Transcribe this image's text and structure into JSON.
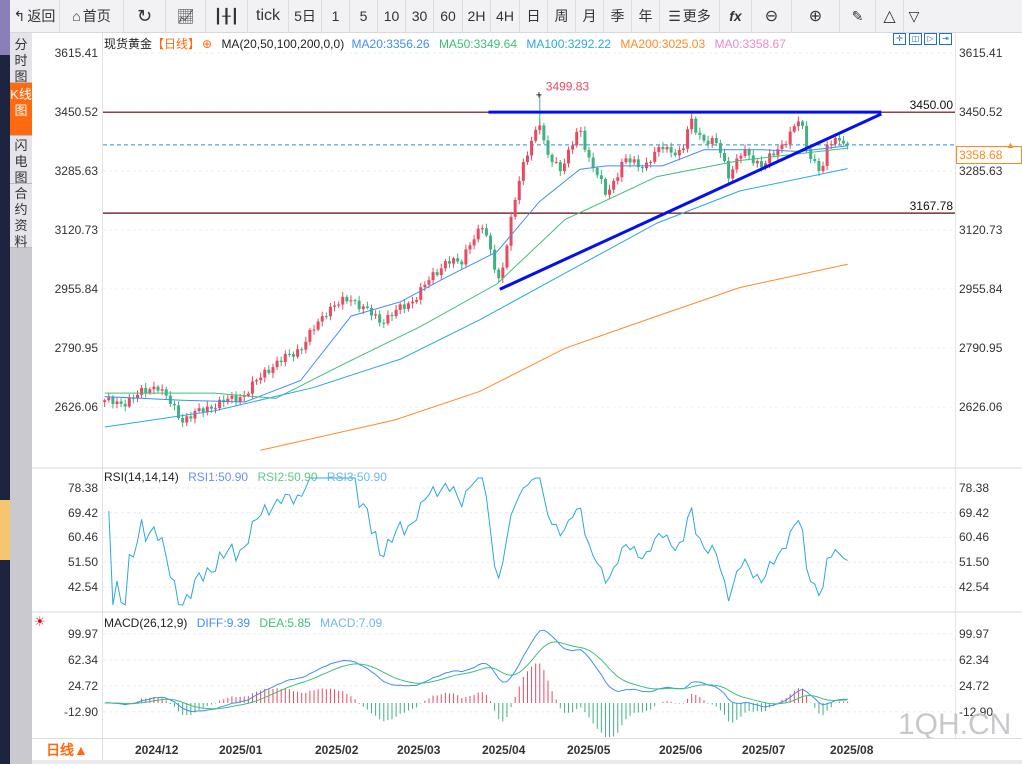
{
  "toolbar": {
    "back": "返回",
    "home": "首页",
    "tick": "tick",
    "p5d": "5日",
    "m1": "1",
    "m5": "5",
    "m10": "10",
    "m30": "30",
    "m60": "60",
    "h2": "2H",
    "h4": "4H",
    "day": "日",
    "week": "周",
    "month": "月",
    "quarter": "季",
    "year": "年",
    "more": "更多",
    "fx": "fx"
  },
  "sidebar": {
    "items": [
      {
        "label": "分时图"
      },
      {
        "label": "K线图",
        "active": true
      },
      {
        "label": "闪电图"
      },
      {
        "label": "合约资料"
      }
    ]
  },
  "main": {
    "symbol": "现货黄金",
    "period": "【日线】",
    "ma_label": "MA(20,50,100,200,0,0)",
    "ma20": "MA20:3356.26",
    "ma50": "MA50:3349.64",
    "ma100": "MA100:3292.22",
    "ma200": "MA200:3025.03",
    "ma0": "MA0:3358.67",
    "axis_ticks": [
      "3615.41",
      "3450.52",
      "3285.63",
      "3120.73",
      "2955.84",
      "2790.95",
      "2626.06"
    ],
    "resistance_label": "3450.00",
    "support_label": "3167.78",
    "high_label": "3499.83",
    "last_price": "3358.68"
  },
  "rsi": {
    "label": "RSI(14,14,14)",
    "rsi1": "RSI1:50.90",
    "rsi2": "RSI2:50.90",
    "rsi3": "RSI3:50.90",
    "axis_ticks": [
      "78.38",
      "69.42",
      "60.46",
      "51.50",
      "42.54"
    ]
  },
  "macd": {
    "label": "MACD(26,12,9)",
    "diff": "DIFF:9.39",
    "dea": "DEA:5.85",
    "macd": "MACD:7.09",
    "axis_ticks": [
      "99.97",
      "62.34",
      "24.72",
      "-12.90"
    ]
  },
  "bottom": {
    "period_button": "日线▲",
    "months": [
      "2024/12",
      "2025/01",
      "2025/02",
      "2025/03",
      "2025/04",
      "2025/05",
      "2025/06",
      "2025/07",
      "2025/08"
    ]
  },
  "watermark": "1QH.CN",
  "colors": {
    "up": "#e84a5f",
    "down": "#3fb27f",
    "ma20": "#3e8ef7",
    "ma50": "#3cc07a",
    "ma100": "#2aa8e0",
    "ma200": "#ff8a2a",
    "trendline": "#0010ee",
    "level": "#5a0a0a",
    "last": "#1f8ff0"
  },
  "chart_data": {
    "type": "candlestick",
    "y_range": [
      2626.06,
      3615.41
    ],
    "closes": [
      [
        "2024-11-21",
        2645
      ],
      [
        "2024-11-26",
        2632
      ],
      [
        "2024-12-10",
        2688
      ],
      [
        "2024-12-19",
        2590
      ],
      [
        "2024-12-31",
        2632
      ],
      [
        "2025-01-10",
        2660
      ],
      [
        "2025-01-17",
        2730
      ],
      [
        "2025-01-28",
        2790
      ],
      [
        "2025-02-06",
        2900
      ],
      [
        "2025-02-14",
        2930
      ],
      [
        "2025-02-24",
        2865
      ],
      [
        "2025-03-07",
        2920
      ],
      [
        "2025-03-14",
        2985
      ],
      [
        "2025-03-20",
        3037
      ],
      [
        "2025-03-25",
        3023
      ],
      [
        "2025-03-28",
        3085
      ],
      [
        "2025-04-02",
        3130
      ],
      [
        "2025-04-08",
        2975
      ],
      [
        "2025-04-14",
        3230
      ],
      [
        "2025-04-17",
        3330
      ],
      [
        "2025-04-22",
        3420
      ],
      [
        "2025-04-24",
        3340
      ],
      [
        "2025-04-30",
        3290
      ],
      [
        "2025-05-06",
        3410
      ],
      [
        "2025-05-09",
        3320
      ],
      [
        "2025-05-15",
        3220
      ],
      [
        "2025-05-21",
        3316
      ],
      [
        "2025-05-28",
        3300
      ],
      [
        "2025-06-03",
        3355
      ],
      [
        "2025-06-10",
        3330
      ],
      [
        "2025-06-13",
        3430
      ],
      [
        "2025-06-18",
        3370
      ],
      [
        "2025-06-23",
        3360
      ],
      [
        "2025-06-27",
        3275
      ],
      [
        "2025-07-02",
        3340
      ],
      [
        "2025-07-09",
        3300
      ],
      [
        "2025-07-15",
        3350
      ],
      [
        "2025-07-22",
        3430
      ],
      [
        "2025-07-25",
        3335
      ],
      [
        "2025-07-30",
        3285
      ],
      [
        "2025-08-01",
        3360
      ],
      [
        "2025-08-06",
        3380
      ],
      [
        "2025-08-08",
        3358.68
      ]
    ],
    "high": {
      "date": "2025-04-22",
      "value": 3499.83
    },
    "ma20": [
      [
        "2024-11-21",
        2655
      ],
      [
        "2024-12-19",
        2645
      ],
      [
        "2025-01-10",
        2640
      ],
      [
        "2025-01-28",
        2700
      ],
      [
        "2025-02-14",
        2880
      ],
      [
        "2025-03-03",
        2920
      ],
      [
        "2025-03-20",
        2990
      ],
      [
        "2025-04-07",
        3060
      ],
      [
        "2025-04-22",
        3200
      ],
      [
        "2025-05-06",
        3290
      ],
      [
        "2025-05-15",
        3300
      ],
      [
        "2025-06-03",
        3300
      ],
      [
        "2025-06-18",
        3345
      ],
      [
        "2025-07-09",
        3345
      ],
      [
        "2025-07-22",
        3340
      ],
      [
        "2025-08-08",
        3356.26
      ]
    ],
    "ma50": [
      [
        "2024-11-21",
        2665
      ],
      [
        "2024-12-31",
        2665
      ],
      [
        "2025-01-20",
        2650
      ],
      [
        "2025-02-10",
        2740
      ],
      [
        "2025-03-10",
        2850
      ],
      [
        "2025-04-07",
        2970
      ],
      [
        "2025-05-01",
        3150
      ],
      [
        "2025-06-01",
        3270
      ],
      [
        "2025-07-01",
        3315
      ],
      [
        "2025-08-08",
        3349.64
      ]
    ],
    "ma100": [
      [
        "2024-11-21",
        2570
      ],
      [
        "2024-12-31",
        2615
      ],
      [
        "2025-02-01",
        2680
      ],
      [
        "2025-03-03",
        2760
      ],
      [
        "2025-04-01",
        2870
      ],
      [
        "2025-05-01",
        3000
      ],
      [
        "2025-06-01",
        3140
      ],
      [
        "2025-07-01",
        3230
      ],
      [
        "2025-08-08",
        3292.22
      ]
    ],
    "ma200": [
      [
        "2025-01-15",
        2505
      ],
      [
        "2025-03-01",
        2590
      ],
      [
        "2025-04-01",
        2670
      ],
      [
        "2025-05-01",
        2790
      ],
      [
        "2025-06-01",
        2880
      ],
      [
        "2025-07-01",
        2960
      ],
      [
        "2025-08-08",
        3025.03
      ]
    ],
    "levels": [
      3450.0,
      3167.78
    ],
    "trendlines": [
      {
        "from": [
          "2025-04-04",
          3450
        ],
        "to": [
          "2025-08-20",
          3450
        ]
      },
      {
        "from": [
          "2025-04-08",
          2955
        ],
        "to": [
          "2025-08-20",
          3445
        ]
      }
    ],
    "rsi_range": [
      42.54,
      78.38
    ],
    "macd_range": [
      -12.9,
      99.97
    ]
  }
}
